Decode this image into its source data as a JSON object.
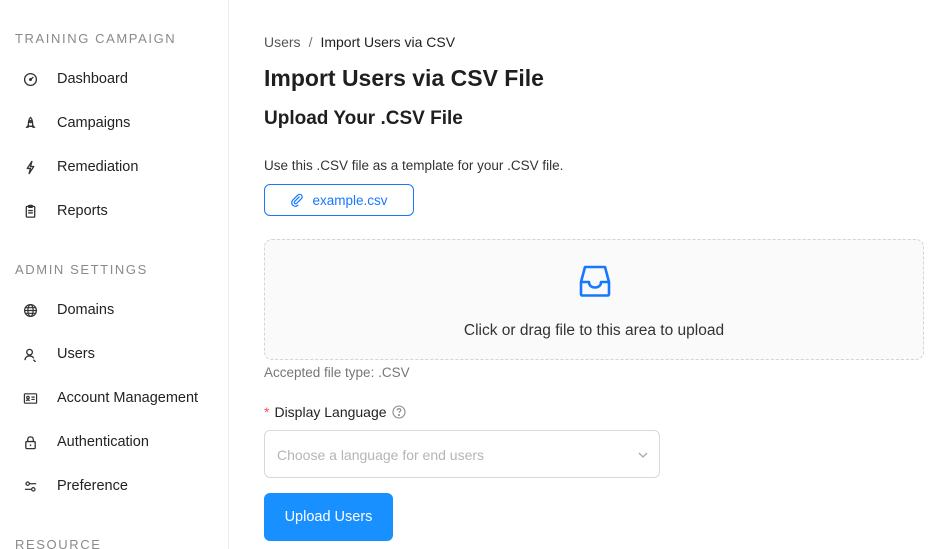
{
  "sidebar": {
    "sections": [
      {
        "title": "TRAINING CAMPAIGN"
      },
      {
        "title": "ADMIN SETTINGS"
      },
      {
        "title": "RESOURCE"
      }
    ],
    "training_items": [
      {
        "label": "Dashboard",
        "icon": "dashboard-icon"
      },
      {
        "label": "Campaigns",
        "icon": "rocket-icon"
      },
      {
        "label": "Remediation",
        "icon": "lightning-icon"
      },
      {
        "label": "Reports",
        "icon": "clipboard-icon"
      }
    ],
    "admin_items": [
      {
        "label": "Domains",
        "icon": "globe-icon"
      },
      {
        "label": "Users",
        "icon": "user-icon"
      },
      {
        "label": "Account Management",
        "icon": "id-card-icon"
      },
      {
        "label": "Authentication",
        "icon": "lock-icon"
      },
      {
        "label": "Preference",
        "icon": "sliders-icon"
      }
    ]
  },
  "breadcrumb": {
    "parent": "Users",
    "separator": "/",
    "current": "Import Users via CSV"
  },
  "main": {
    "title": "Import Users via CSV File",
    "subtitle": "Upload Your .CSV File",
    "template_text": "Use this .CSV file as a template for your .CSV file.",
    "example_file": "example.csv",
    "dropzone_hint": "Click or drag file to this area to upload",
    "accepted_types": "Accepted file type: .CSV",
    "language_label": "Display Language",
    "required_mark": "*",
    "language_placeholder": "Choose a language for end users",
    "upload_button": "Upload Users"
  },
  "colors": {
    "primary": "#1890ff",
    "link": "#1677ff",
    "required": "#ff4d4f"
  }
}
